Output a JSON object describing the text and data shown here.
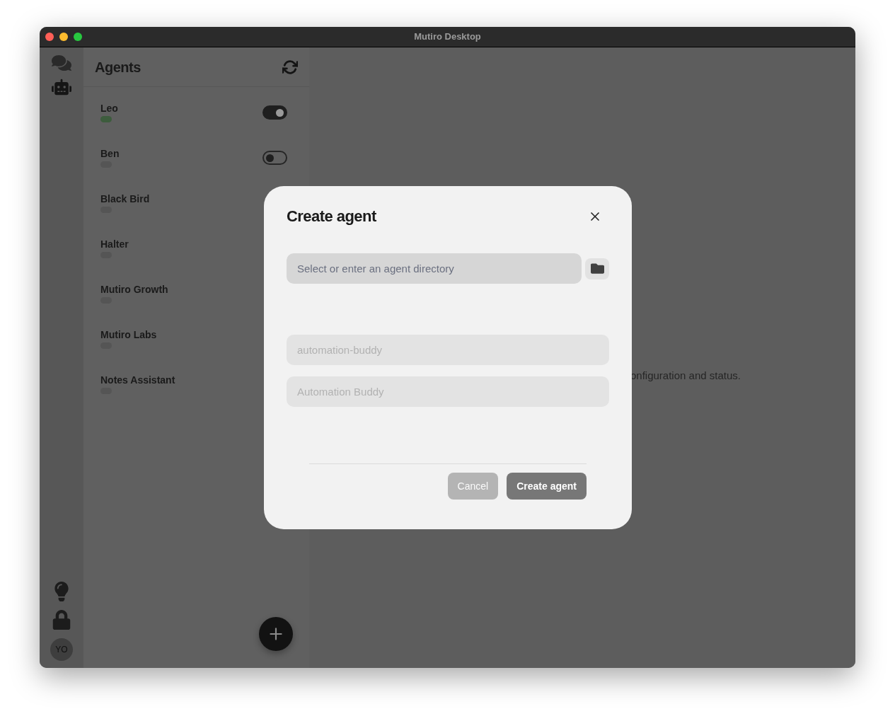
{
  "window": {
    "title": "Mutiro Desktop"
  },
  "rail": {
    "top_items": [
      {
        "kind": "chats",
        "selected": false
      },
      {
        "kind": "agents",
        "selected": true
      }
    ],
    "bottom_items": [
      {
        "kind": "ideas"
      },
      {
        "kind": "lock"
      }
    ],
    "avatar": "YO"
  },
  "agents_panel": {
    "title": "Agents",
    "agents": [
      {
        "name": "Leo",
        "color": "#3d5c3d",
        "on": true
      },
      {
        "name": "Ben",
        "color": "#555555",
        "on": false
      },
      {
        "name": "Black Bird",
        "color": "#555555"
      },
      {
        "name": "Halter",
        "color": "#555555"
      },
      {
        "name": "Mutiro Growth",
        "color": "#555555"
      },
      {
        "name": "Mutiro Labs",
        "color": "#555555"
      },
      {
        "name": "Notes Assistant",
        "color": "#555555"
      }
    ]
  },
  "main": {
    "text": "onfiguration and status."
  },
  "dialog": {
    "title": "Create agent",
    "fields": [
      {
        "kind": "directory",
        "placeholder": "Select or enter an agent directory",
        "disabled": false
      },
      {
        "kind": "text",
        "placeholder": "automation-buddy",
        "disabled": true
      },
      {
        "kind": "text",
        "placeholder": "Automation Buddy",
        "disabled": true
      }
    ],
    "buttons": [
      {
        "label": "Cancel",
        "disabled": true
      },
      {
        "label": "Create agent",
        "disabled": false
      }
    ]
  }
}
